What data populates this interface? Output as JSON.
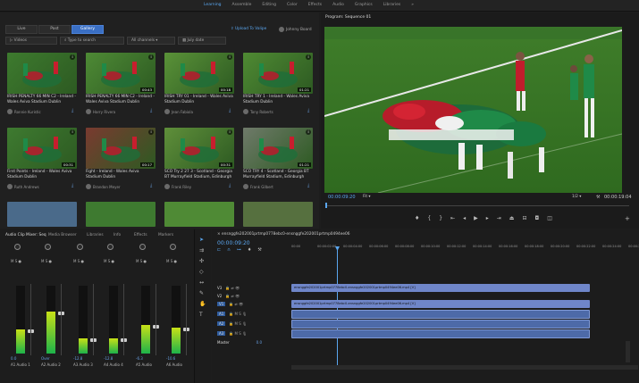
{
  "top_nav": {
    "items": [
      "Learning",
      "Assemble",
      "Editing",
      "Color",
      "Effects",
      "Audio",
      "Graphics",
      "Libraries"
    ],
    "active": "Learning"
  },
  "source_panel": {
    "tabs": [
      "Live",
      "Past",
      "Gallery"
    ],
    "active_tab": "Gallery",
    "filter_type": "Videos",
    "search_placeholder": "Type to search",
    "channels": "All channels",
    "date": "July date",
    "upload_label": "Upload To Valipe",
    "user": "Johnny Board",
    "thumbnails": [
      {
        "title": "IRISH PENALTY 66 MIN C2 - Ireland - Wales Aviva Stadium Dublin",
        "author": "Ronnie Kuristic",
        "duration": "",
        "color": "#3d7a2e"
      },
      {
        "title": "IRISH PENALTY 66 MIN C2 - Ireland - Wales Aviva Stadium Dublin",
        "author": "Harry Rivera",
        "duration": "00:43",
        "color": "#4e8a35"
      },
      {
        "title": "IRISH TRY 01 - Ireland - Wales Aviva Stadium Dublin",
        "author": "Jean Fabiola",
        "duration": "00:18",
        "color": "#5a9238"
      },
      {
        "title": "IRISH TRY 1 - Ireland - Wales Aviva Stadium Dublin",
        "author": "Tony Roberts",
        "duration": "01:21",
        "color": "#4f8a33"
      },
      {
        "title": "First Points - Ireland - Wales Aviva Stadium Dublin",
        "author": "Ruth Andrews",
        "duration": "00:31",
        "color": "#3e7a30"
      },
      {
        "title": "Fight - Ireland - Wales Aviva Stadium Dublin",
        "author": "Brandon Meyer",
        "duration": "00:17",
        "color": "#7a3a30"
      },
      {
        "title": "SCO Try 2 27 3 - Scotland - Georgia BT Murrayfield Stadium, Edinburgh",
        "author": "Frank Riley",
        "duration": "00:31",
        "color": "#5f8f3a"
      },
      {
        "title": "SCO TRY 4 - Scotland - Georgia BT Murrayfield Stadium, Edinburgh",
        "author": "Frank Gilbert",
        "duration": "01:21",
        "color": "#6f7a6a"
      }
    ]
  },
  "program_monitor": {
    "title": "Program: Sequence 01",
    "timecode": "00:00:09:20",
    "fit": "Fit",
    "ratio": "1/2",
    "duration": "00:00:19:04"
  },
  "mixer": {
    "tabs": [
      "Audio Clip Mixer: Seq",
      "Media Browser",
      "Libraries",
      "Info",
      "Effects",
      "Markers"
    ],
    "channels": [
      {
        "name": "Audio 1",
        "tag": "A1",
        "value": "0.0",
        "level": 0.35
      },
      {
        "name": "Audio 2",
        "tag": "A2",
        "value": "Over",
        "level": 0.62
      },
      {
        "name": "Audio 3",
        "tag": "A3",
        "value": "-12.8",
        "level": 0.22
      },
      {
        "name": "Audio 4",
        "tag": "A4",
        "value": "-12.8",
        "level": 0.22
      },
      {
        "name": "Audio",
        "tag": "A5",
        "value": "-6.3",
        "level": 0.42
      },
      {
        "name": "Audio",
        "tag": "A6",
        "value": "-10.6",
        "level": 0.38
      }
    ]
  },
  "timeline": {
    "sequence_name": "ensnggfe202001prtmp0778ebc0-ensnggfe202001prtmp0494ee06",
    "timecode": "00:00:09:20",
    "ruler": [
      "00:00",
      "00:00:02:00",
      "00:00:04:00",
      "00:00:06:00",
      "00:00:08:00",
      "00:00:10:00",
      "00:00:12:00",
      "00:00:14:00",
      "00:00:16:00",
      "00:00:18:00",
      "00:00:20:00",
      "00:00:22:00",
      "00:00:24:00",
      "00:00:26:00"
    ],
    "tracks": [
      "V3",
      "V2",
      "V1",
      "A1",
      "A2",
      "A3",
      "Master"
    ],
    "video_clip_1": "ensnggfe202001prtmp0778ebc0-ensnggfe202001prtmp0494ee06.mp4 [V]",
    "video_clip_2": "ensnggfe202001prtmp0778ebc0-ensnggfe202001prtmp0494ee06.mp4 [V]",
    "master_value": "0.0"
  }
}
